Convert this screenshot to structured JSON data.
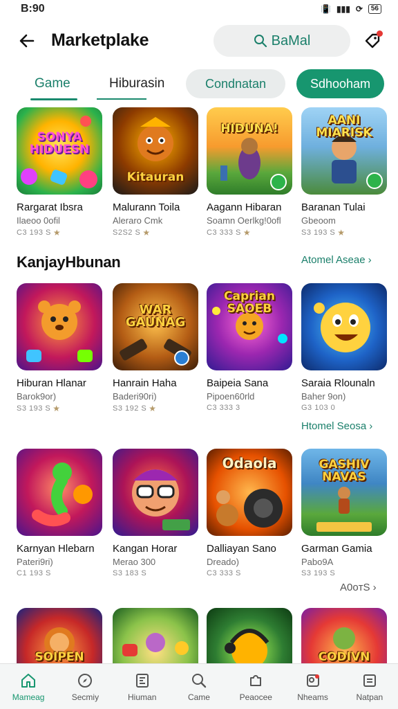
{
  "status_bar": {
    "time": "B:90",
    "battery": "56"
  },
  "header": {
    "title": "Marketplake",
    "search_label": "BaMal"
  },
  "tabs": {
    "game": "Game",
    "hiburasin": "Hiburasin",
    "chip_gray": "Condnatan",
    "chip_green": "Sdhooham"
  },
  "section": {
    "title": "KanjayHbunan",
    "more_1": "Atomel Aseae",
    "more_2": "Htomel Seosa",
    "more_3": "A0oтS"
  },
  "rows": [
    [
      {
        "thumb": "SONYA HIDUESN",
        "title": "Rargarat Ibsra",
        "sub": "Ilaeoo 0ofil",
        "rating": "C3 193 S"
      },
      {
        "thumb": "Kitauran",
        "title": "Malurann Toila",
        "sub": "Alerarо Cmk",
        "rating": "S2S2 S"
      },
      {
        "thumb": "HIDUNA!",
        "title": "Aagann Hibaran",
        "sub": "Soamn Oerlkg!0ofl",
        "rating": "C3 333 S"
      },
      {
        "thumb": "AANI MIARISK",
        "title": "Baranan Tulai",
        "sub": "Gbeoom",
        "rating": "S3 193 S"
      }
    ],
    [
      {
        "thumb": "",
        "title": "Hiburan Hlanar",
        "sub": "Barok9or)",
        "rating": "S3 193 S"
      },
      {
        "thumb": "WAR GAUNAG",
        "title": "Hanrain Haha",
        "sub": "Baderi90ri)",
        "rating": "S3 192 S"
      },
      {
        "thumb": "Caprian SAOEB",
        "title": "Baipeia Sana",
        "sub": "Pipoen60rld",
        "rating": "C3 333 3"
      },
      {
        "thumb": "",
        "title": "Saraia Rlounaln",
        "sub": "Baher 9on)",
        "rating": "G3 103 0"
      }
    ],
    [
      {
        "thumb": "",
        "title": "Karnyan Hlebarn",
        "sub": "Pateri9ri)",
        "rating": "C1 193 S"
      },
      {
        "thumb": "",
        "title": "Kangan Horar",
        "sub": "Merao 300",
        "rating": "S3 183 S"
      },
      {
        "thumb": "Odaola",
        "title": "Dalliayan Sano",
        "sub": "Dreado)",
        "rating": "C3 333 S"
      },
      {
        "thumb": "GASHIV NAVAS",
        "title": "Garman Gamia",
        "sub": "Pabo9A",
        "rating": "S3 193 S"
      }
    ],
    [
      {
        "thumb": "SOIPEN"
      },
      {
        "thumb": ""
      },
      {
        "thumb": ""
      },
      {
        "thumb": "CODIVN"
      }
    ]
  ],
  "bottom_nav": [
    "Mameag",
    "Secmiy",
    "Hiuman",
    "Came",
    "Peaocee",
    "Nheams",
    "Natpan"
  ],
  "colors": {
    "accent": "#17966f",
    "accent_text": "#1a7f6a",
    "chip_gray": "#e9ecec"
  }
}
